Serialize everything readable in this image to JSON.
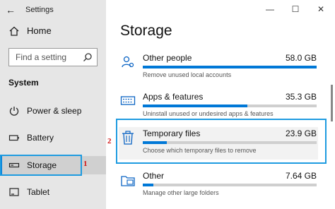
{
  "window": {
    "title": "Settings",
    "colors": {
      "accent": "#0078d7",
      "highlight": "#1e9be0",
      "callout": "#d01010"
    }
  },
  "nav": {
    "home_label": "Home",
    "search_placeholder": "Find a setting",
    "section_title": "System",
    "items": [
      {
        "label": "Power & sleep",
        "icon": "power-icon"
      },
      {
        "label": "Battery",
        "icon": "battery-icon"
      },
      {
        "label": "Storage",
        "icon": "storage-icon",
        "active": true
      },
      {
        "label": "Tablet",
        "icon": "tablet-icon"
      }
    ]
  },
  "callouts": {
    "storage": "1",
    "temp_files": "2"
  },
  "main": {
    "title": "Storage",
    "rows": [
      {
        "name": "Other people",
        "size": "58.0 GB",
        "desc": "Remove unused local accounts",
        "fill": 1.0,
        "icon": "people-icon"
      },
      {
        "name": "Apps & features",
        "size": "35.3 GB",
        "desc": "Uninstall unused or undesired apps & features",
        "fill": 0.6,
        "icon": "keyboard-icon"
      },
      {
        "name": "Temporary files",
        "size": "23.9 GB",
        "desc": "Choose which temporary files to remove",
        "fill": 0.14,
        "icon": "trash-icon"
      },
      {
        "name": "Other",
        "size": "7.64 GB",
        "desc": "Manage other large folders",
        "fill": 0.06,
        "icon": "folder-icon"
      }
    ]
  }
}
